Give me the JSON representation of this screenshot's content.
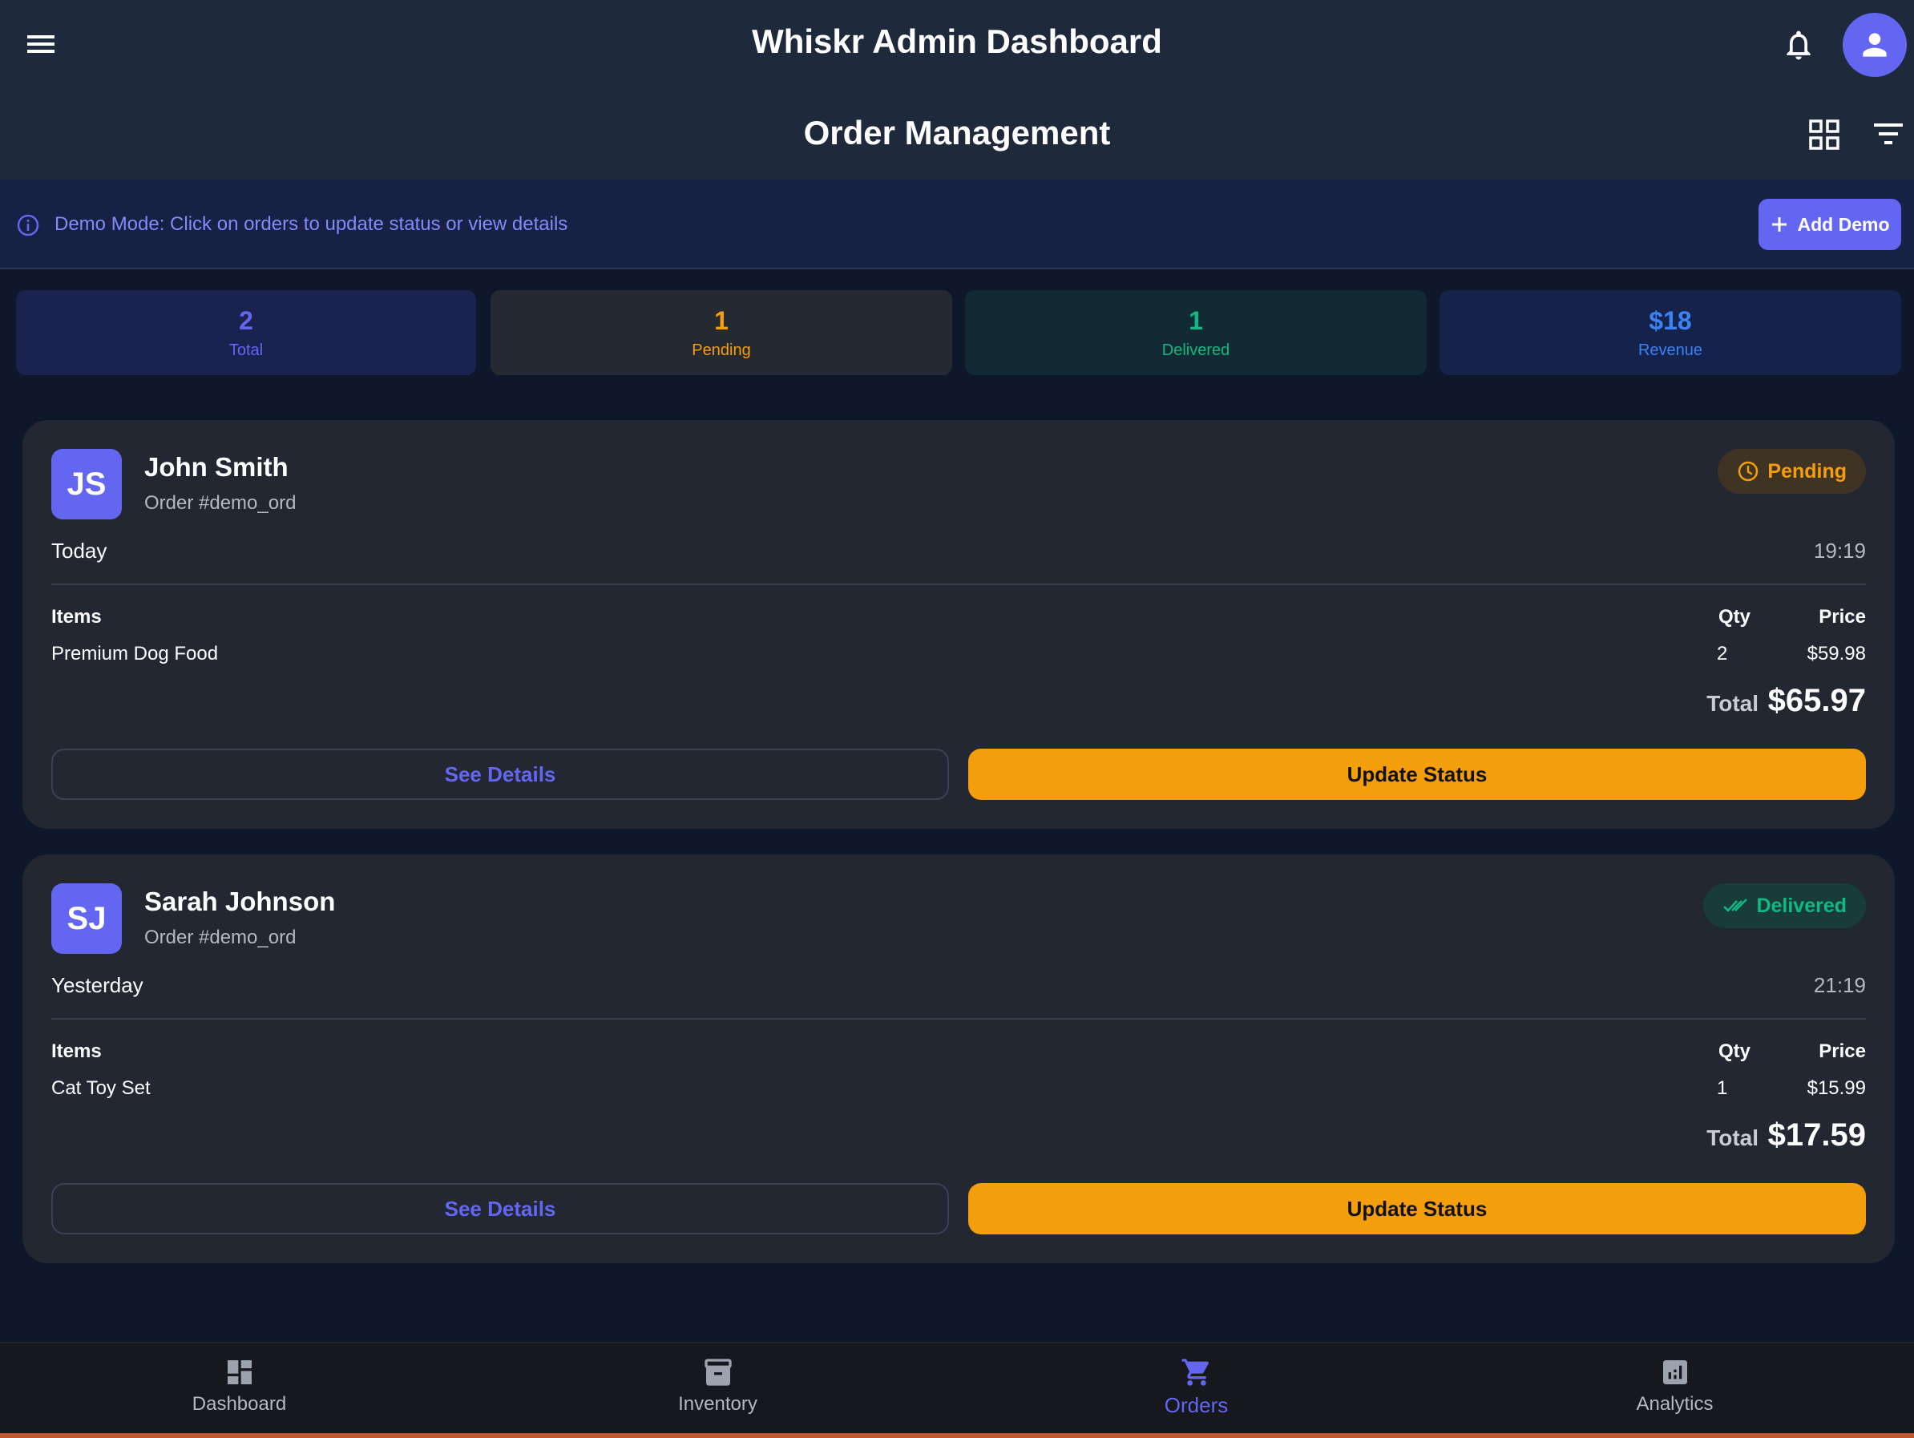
{
  "app_bar": {
    "title": "Whiskr Admin Dashboard",
    "menu_icon": "hamburger-menu-icon",
    "notification_icon": "bell-icon",
    "profile_icon": "person-icon"
  },
  "page": {
    "title": "Order Management",
    "view_toggle_icon": "grid-view-icon",
    "filter_icon": "filter-list-icon"
  },
  "demo_banner": {
    "icon": "info-icon",
    "text": "Demo Mode: Click on orders to update status or view details",
    "button_label": "Add Demo"
  },
  "stats": {
    "total": {
      "value": "2",
      "label": "Total"
    },
    "pending": {
      "value": "1",
      "label": "Pending"
    },
    "delivered": {
      "value": "1",
      "label": "Delivered"
    },
    "revenue": {
      "value": "$18",
      "label": "Revenue"
    }
  },
  "orders": [
    {
      "initials": "JS",
      "customer": "John Smith",
      "order_id": "Order #demo_ord",
      "status": "Pending",
      "status_icon": "clock-icon",
      "day": "Today",
      "time": "19:19",
      "items_header": "Items",
      "qty_header": "Qty",
      "price_header": "Price",
      "item_name": "Premium Dog Food",
      "item_qty": "2",
      "item_price": "$59.98",
      "total_label": "Total",
      "total_value": "$65.97",
      "details_label": "See Details",
      "update_label": "Update Status"
    },
    {
      "initials": "SJ",
      "customer": "Sarah Johnson",
      "order_id": "Order #demo_ord",
      "status": "Delivered",
      "status_icon": "double-check-icon",
      "day": "Yesterday",
      "time": "21:19",
      "items_header": "Items",
      "qty_header": "Qty",
      "price_header": "Price",
      "item_name": "Cat Toy Set",
      "item_qty": "1",
      "item_price": "$15.99",
      "total_label": "Total",
      "total_value": "$17.59",
      "details_label": "See Details",
      "update_label": "Update Status"
    }
  ],
  "bottom_nav": [
    {
      "label": "Dashboard",
      "icon": "dashboard-icon",
      "active": false
    },
    {
      "label": "Inventory",
      "icon": "inventory-box-icon",
      "active": false
    },
    {
      "label": "Orders",
      "icon": "shopping-cart-icon",
      "active": true
    },
    {
      "label": "Analytics",
      "icon": "analytics-chart-icon",
      "active": false
    }
  ],
  "colors": {
    "accent": "#6366f1",
    "pending": "#f59e0b",
    "delivered": "#10b981",
    "revenue": "#3b82f6",
    "background": "#0f172a",
    "card": "#232731"
  }
}
